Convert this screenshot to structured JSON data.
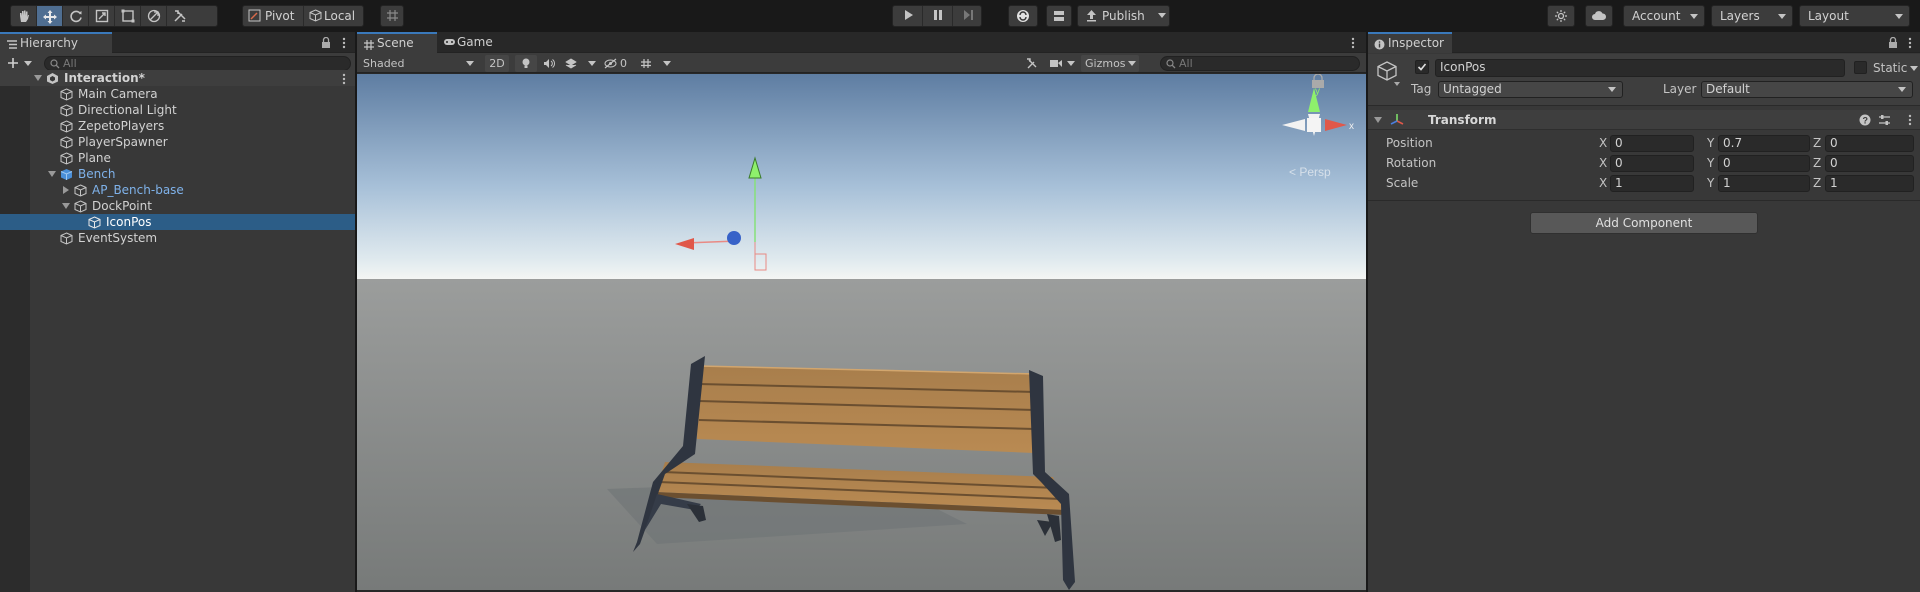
{
  "toolbar": {
    "pivot_label": "Pivot",
    "local_label": "Local",
    "publish_label": "Publish",
    "account_label": "Account",
    "layers_label": "Layers",
    "layout_label": "Layout"
  },
  "hierarchy": {
    "tab_label": "Hierarchy",
    "search_placeholder": "All",
    "items": [
      {
        "label": "Interaction*"
      },
      {
        "label": "Main Camera"
      },
      {
        "label": "Directional Light"
      },
      {
        "label": "ZepetoPlayers"
      },
      {
        "label": "PlayerSpawner"
      },
      {
        "label": "Plane"
      },
      {
        "label": "Bench"
      },
      {
        "label": "AP_Bench-base"
      },
      {
        "label": "DockPoint"
      },
      {
        "label": "IconPos"
      },
      {
        "label": "EventSystem"
      }
    ]
  },
  "scene": {
    "tab_scene": "Scene",
    "tab_game": "Game",
    "shading_mode": "Shaded",
    "mode_2d": "2D",
    "hidden_count": "0",
    "gizmos_label": "Gizmos",
    "search_placeholder": "All",
    "persp_label": "< Persp",
    "axis_y": "y",
    "axis_x": "x"
  },
  "inspector": {
    "tab_label": "Inspector",
    "object_name": "IconPos",
    "static_label": "Static",
    "tag_label": "Tag",
    "tag_value": "Untagged",
    "layer_label": "Layer",
    "layer_value": "Default",
    "component_title": "Transform",
    "rows": [
      {
        "label": "Position",
        "x": "0",
        "y": "0.7",
        "z": "0"
      },
      {
        "label": "Rotation",
        "x": "0",
        "y": "0",
        "z": "0"
      },
      {
        "label": "Scale",
        "x": "1",
        "y": "1",
        "z": "1"
      }
    ],
    "axis_x": "X",
    "axis_y": "Y",
    "axis_z": "Z",
    "add_component": "Add Component"
  },
  "colors": {
    "accent": "#3a79bb",
    "selection": "#2c5d87",
    "prefab_text": "#7fb2ea"
  }
}
